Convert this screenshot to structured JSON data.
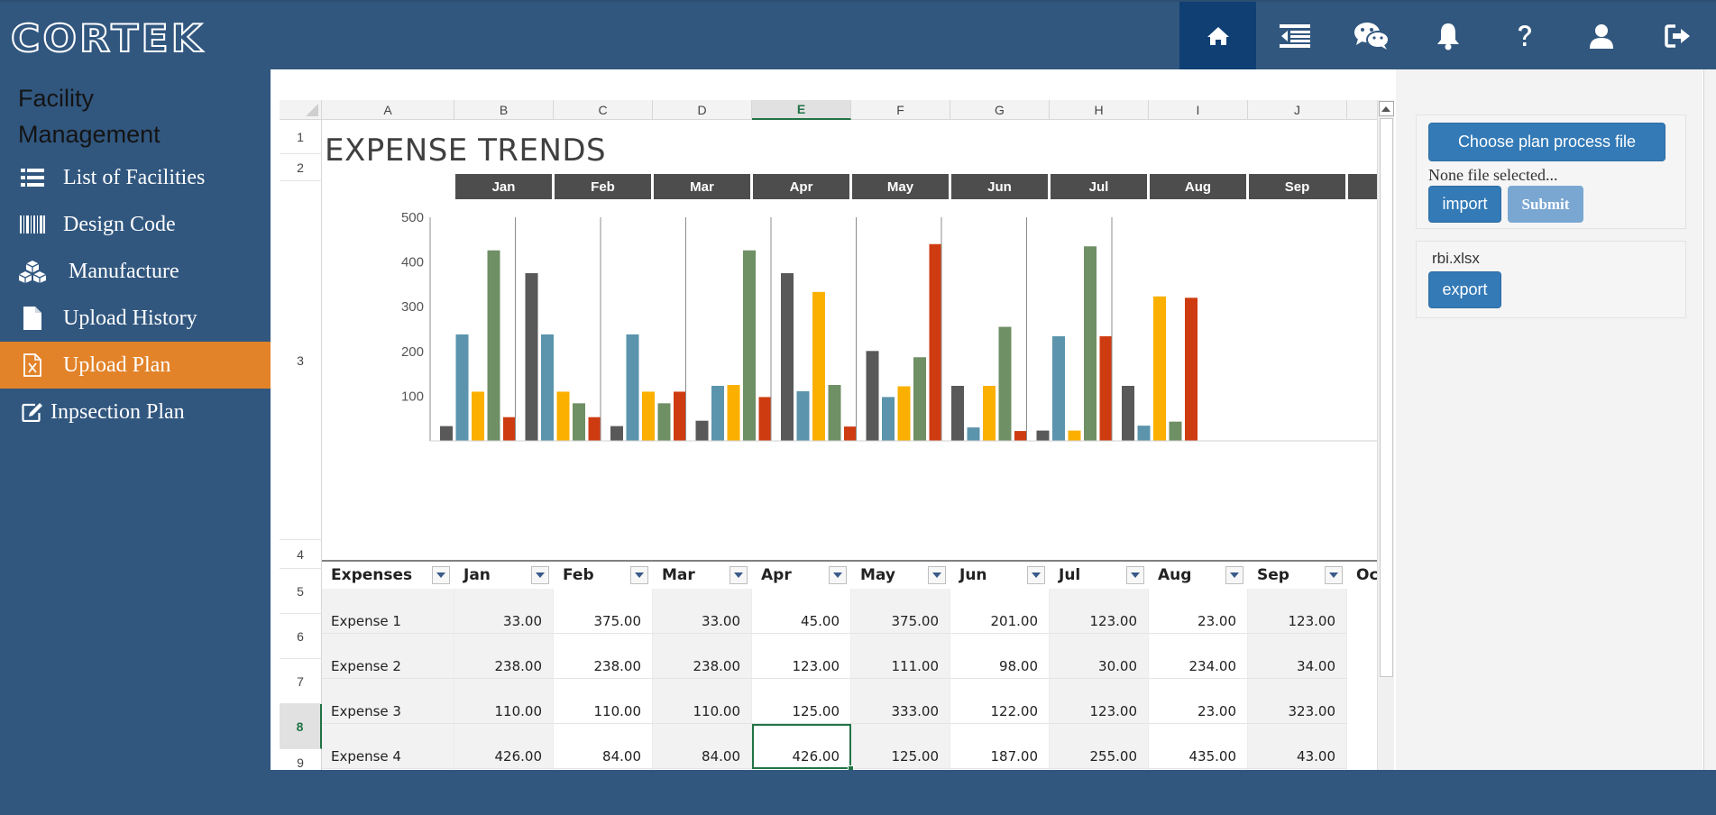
{
  "app": {
    "logo_text": "CORTEK"
  },
  "top_nav": [
    {
      "icon": "home-icon",
      "active": true
    },
    {
      "icon": "menu-collapse-icon",
      "active": false
    },
    {
      "icon": "wechat-icon",
      "active": false
    },
    {
      "icon": "bell-icon",
      "active": false
    },
    {
      "icon": "help-icon",
      "active": false
    },
    {
      "icon": "user-icon",
      "active": false
    },
    {
      "icon": "logout-icon",
      "active": false
    }
  ],
  "sidebar": {
    "title_line1": "Facility",
    "title_line2": "Management",
    "items": [
      {
        "label": "List of Facilities",
        "icon": "list-icon",
        "active": false
      },
      {
        "label": "Design Code",
        "icon": "barcode-icon",
        "active": false
      },
      {
        "label": "Manufacture",
        "icon": "cubes-icon",
        "active": false
      },
      {
        "label": "Upload History",
        "icon": "file-icon",
        "active": false
      },
      {
        "label": "Upload Plan",
        "icon": "excel-file-icon",
        "active": true
      },
      {
        "label": "Inpsection Plan",
        "icon": "edit-icon",
        "active": false
      }
    ]
  },
  "sheet": {
    "columns": [
      "A",
      "B",
      "C",
      "D",
      "E",
      "F",
      "G",
      "H",
      "I",
      "J"
    ],
    "selected_column": "E",
    "rows": [
      "1",
      "2",
      "3",
      "4",
      "5",
      "6",
      "7",
      "8",
      "9"
    ],
    "selected_row": "8",
    "title": "EXPENSE TRENDS",
    "months": [
      "Jan",
      "Feb",
      "Mar",
      "Apr",
      "May",
      "Jun",
      "Jul",
      "Aug",
      "Sep"
    ],
    "table_header": [
      "Expenses",
      "Jan",
      "Feb",
      "Mar",
      "Apr",
      "May",
      "Jun",
      "Jul",
      "Aug",
      "Sep",
      "Oc"
    ],
    "table_rows": [
      {
        "label": "Expense 1",
        "values": [
          "33.00",
          "375.00",
          "33.00",
          "45.00",
          "375.00",
          "201.00",
          "123.00",
          "23.00",
          "123.00"
        ]
      },
      {
        "label": "Expense 2",
        "values": [
          "238.00",
          "238.00",
          "238.00",
          "123.00",
          "111.00",
          "98.00",
          "30.00",
          "234.00",
          "34.00"
        ]
      },
      {
        "label": "Expense 3",
        "values": [
          "110.00",
          "110.00",
          "110.00",
          "125.00",
          "333.00",
          "122.00",
          "123.00",
          "23.00",
          "323.00"
        ]
      },
      {
        "label": "Expense 4",
        "values": [
          "426.00",
          "84.00",
          "84.00",
          "426.00",
          "125.00",
          "187.00",
          "255.00",
          "435.00",
          "43.00"
        ]
      }
    ],
    "active_cell": "E8"
  },
  "chart_data": {
    "type": "bar",
    "categories": [
      "Jan",
      "Feb",
      "Mar",
      "Apr",
      "May",
      "Jun",
      "Jul",
      "Aug",
      "Sep"
    ],
    "series": [
      {
        "values": [
          33,
          375,
          33,
          45,
          375,
          201,
          123,
          23,
          123
        ],
        "color": "#595959"
      },
      {
        "values": [
          238,
          238,
          238,
          123,
          111,
          98,
          30,
          234,
          34
        ],
        "color": "#5b94ac"
      },
      {
        "values": [
          110,
          110,
          110,
          125,
          333,
          122,
          123,
          23,
          323
        ],
        "color": "#fbb000"
      },
      {
        "values": [
          426,
          84,
          84,
          426,
          125,
          187,
          255,
          435,
          43
        ],
        "color": "#6f8f65"
      },
      {
        "values": [
          53,
          53,
          110,
          98,
          32,
          440,
          22,
          234,
          320
        ],
        "color": "#cf3b11"
      }
    ],
    "ylim": [
      0,
      500
    ],
    "yticks": [
      "100",
      "200",
      "300",
      "400",
      "500"
    ],
    "grid": false,
    "legend": "none"
  },
  "right_panel": {
    "choose_label": "Choose plan process file",
    "file_status": "None file selected...",
    "import_label": "import",
    "submit_label": "Submit",
    "export_file": "rbi.xlsx",
    "export_label": "export"
  }
}
